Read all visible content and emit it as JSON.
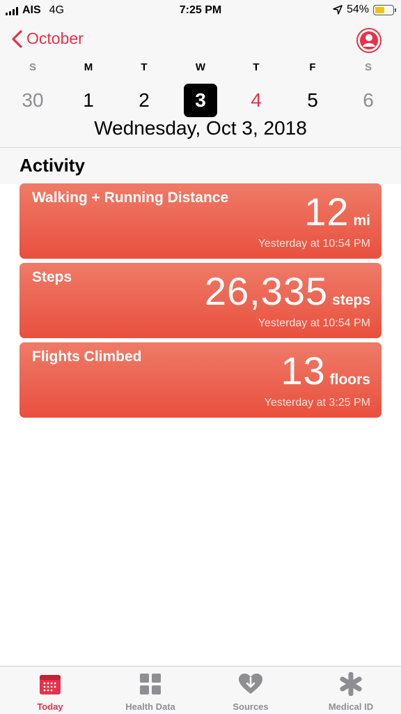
{
  "status_bar": {
    "carrier": "AIS",
    "network": "4G",
    "time": "7:25 PM",
    "battery_percent_label": "54%",
    "battery_level": 0.54
  },
  "header": {
    "back_label": "October",
    "weekdays": [
      "S",
      "M",
      "T",
      "W",
      "T",
      "F",
      "S"
    ],
    "dates": [
      "30",
      "1",
      "2",
      "3",
      "4",
      "5",
      "6"
    ],
    "selected_index": 3,
    "full_date": "Wednesday, Oct 3, 2018"
  },
  "activity": {
    "title": "Activity",
    "cards": [
      {
        "label": "Walking + Running Distance",
        "value": "12",
        "unit": "mi",
        "time": "Yesterday at 10:54 PM"
      },
      {
        "label": "Steps",
        "value": "26,335",
        "unit": "steps",
        "time": "Yesterday at 10:54 PM"
      },
      {
        "label": "Flights Climbed",
        "value": "13",
        "unit": "floors",
        "time": "Yesterday at 3:25 PM"
      }
    ]
  },
  "tabbar": {
    "tabs": [
      {
        "label": "Today",
        "icon": "calendar-icon",
        "active": true
      },
      {
        "label": "Health Data",
        "icon": "grid-icon",
        "active": false
      },
      {
        "label": "Sources",
        "icon": "heart-download-icon",
        "active": false
      },
      {
        "label": "Medical ID",
        "icon": "asterisk-icon",
        "active": false
      }
    ]
  },
  "colors": {
    "accent": "#e4334a",
    "card_top": "#ee7b68",
    "card_bottom": "#e9503d",
    "muted_date": "#8e8e93",
    "today_red": "#e4334a"
  }
}
